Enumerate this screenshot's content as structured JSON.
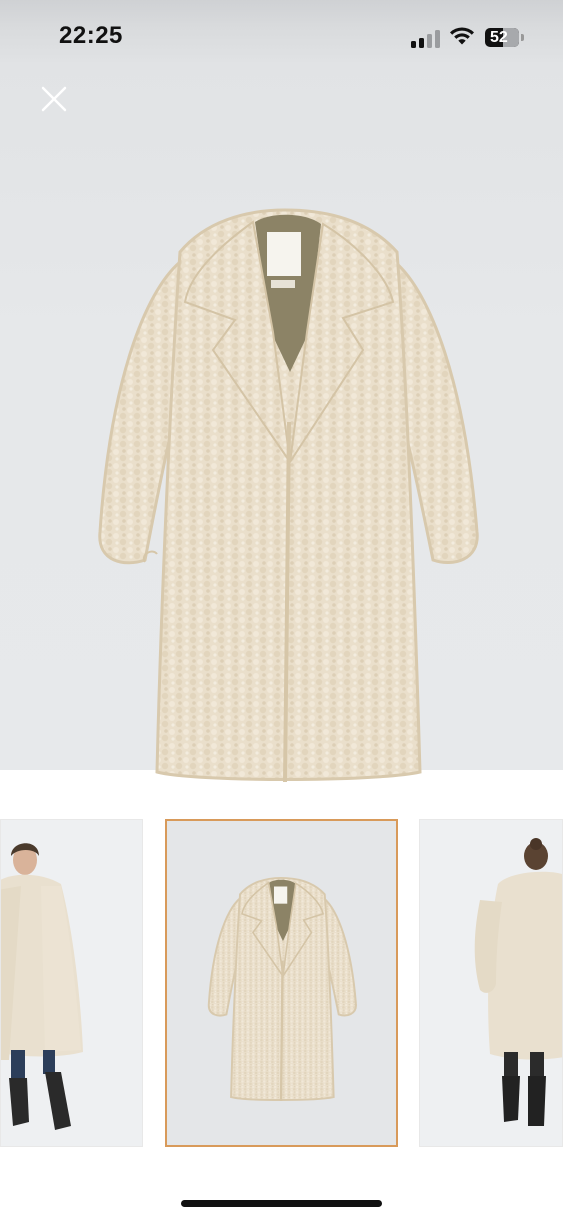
{
  "status_bar": {
    "time": "22:25",
    "battery_level": "52",
    "signal_icon": "cellular-signal-icon",
    "wifi_icon": "wifi-icon"
  },
  "viewer": {
    "close_icon": "close-icon",
    "main_image": "beige-teddy-coat-product-photo",
    "thumbnails": [
      {
        "image": "model-wearing-coat-front",
        "selected": false
      },
      {
        "image": "beige-teddy-coat-product-photo",
        "selected": true
      },
      {
        "image": "model-wearing-coat-back",
        "selected": false
      }
    ]
  },
  "colors": {
    "coat": "#eadfcb",
    "selection_border": "#d89a5a",
    "background": "#e6e8ea"
  }
}
